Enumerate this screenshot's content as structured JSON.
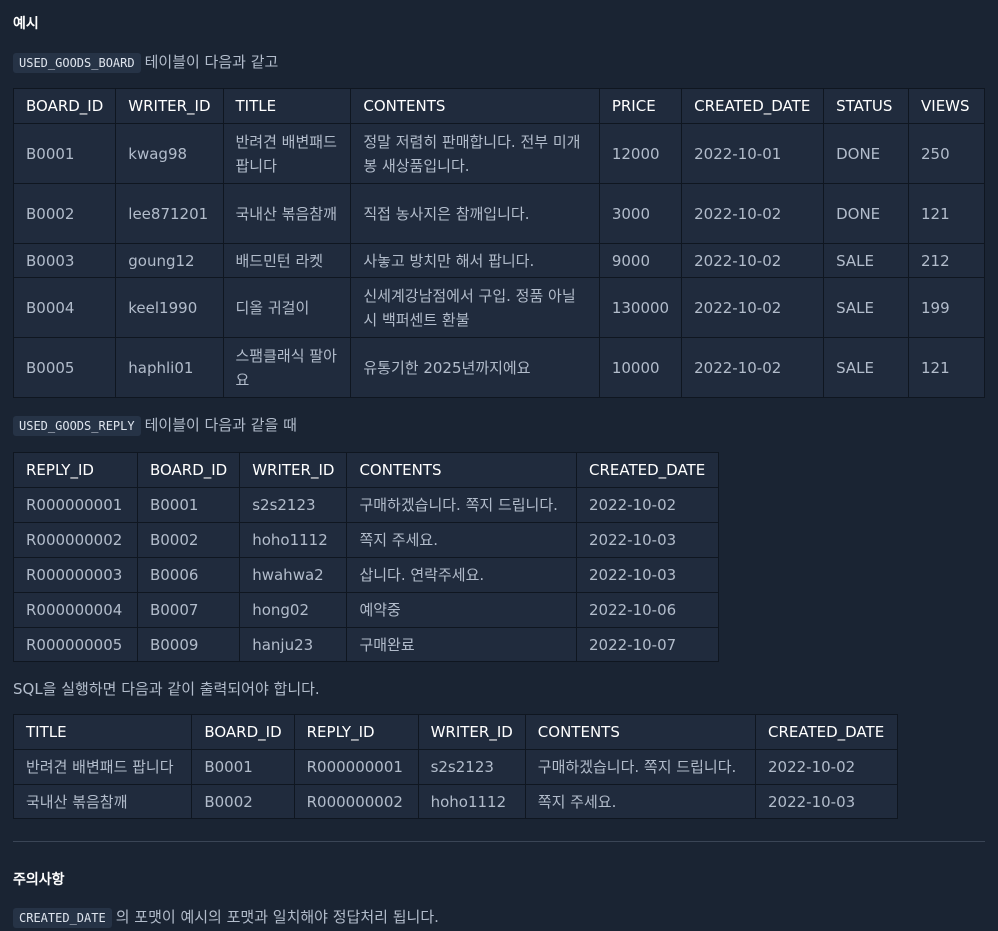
{
  "heading_example": "예시",
  "board_intro": {
    "code": "USED_GOODS_BOARD",
    "text": "테이블이 다음과 같고"
  },
  "board_table": {
    "headers": [
      "BOARD_ID",
      "WRITER_ID",
      "TITLE",
      "CONTENTS",
      "PRICE",
      "CREATED_DATE",
      "STATUS",
      "VIEWS"
    ],
    "rows": [
      [
        "B0001",
        "kwag98",
        "반려견 배변패드 팝니다",
        "정말 저렴히 판매합니다. 전부 미개봉 새상품입니다.",
        "12000",
        "2022-10-01",
        "DONE",
        "250"
      ],
      [
        "B0002",
        "lee871201",
        "국내산 볶음참깨",
        "직접 농사지은 참깨입니다.",
        "3000",
        "2022-10-02",
        "DONE",
        "121"
      ],
      [
        "B0003",
        "goung12",
        "배드민턴 라켓",
        "사놓고 방치만 해서 팝니다.",
        "9000",
        "2022-10-02",
        "SALE",
        "212"
      ],
      [
        "B0004",
        "keel1990",
        "디올 귀걸이",
        "신세계강남점에서 구입. 정품 아닐시 백퍼센트 환불",
        "130000",
        "2022-10-02",
        "SALE",
        "199"
      ],
      [
        "B0005",
        "haphli01",
        "스팸클래식 팔아요",
        "유통기한 2025년까지에요",
        "10000",
        "2022-10-02",
        "SALE",
        "121"
      ]
    ]
  },
  "reply_intro": {
    "code": "USED_GOODS_REPLY",
    "text": "테이블이 다음과 같을 때"
  },
  "reply_table": {
    "headers": [
      "REPLY_ID",
      "BOARD_ID",
      "WRITER_ID",
      "CONTENTS",
      "CREATED_DATE"
    ],
    "rows": [
      [
        "R000000001",
        "B0001",
        "s2s2123",
        "구매하겠습니다. 쪽지 드립니다.",
        "2022-10-02"
      ],
      [
        "R000000002",
        "B0002",
        "hoho1112",
        "쪽지 주세요.",
        "2022-10-03"
      ],
      [
        "R000000003",
        "B0006",
        "hwahwa2",
        "삽니다. 연락주세요.",
        "2022-10-03"
      ],
      [
        "R000000004",
        "B0007",
        "hong02",
        "예약중",
        "2022-10-06"
      ],
      [
        "R000000005",
        "B0009",
        "hanju23",
        "구매완료",
        "2022-10-07"
      ]
    ]
  },
  "result_intro": "SQL을 실행하면 다음과 같이 출력되어야 합니다.",
  "result_table": {
    "headers": [
      "TITLE",
      "BOARD_ID",
      "REPLY_ID",
      "WRITER_ID",
      "CONTENTS",
      "CREATED_DATE"
    ],
    "rows": [
      [
        "반려견 배변패드 팝니다",
        "B0001",
        "R000000001",
        "s2s2123",
        "구매하겠습니다. 쪽지 드립니다.",
        "2022-10-02"
      ],
      [
        "국내산 볶음참깨",
        "B0002",
        "R000000002",
        "hoho1112",
        "쪽지 주세요.",
        "2022-10-03"
      ]
    ]
  },
  "heading_notes": "주의사항",
  "note": {
    "code": "CREATED_DATE",
    "text": "의 포맷이 예시의 포맷과 일치해야 정답처리 됩니다."
  }
}
